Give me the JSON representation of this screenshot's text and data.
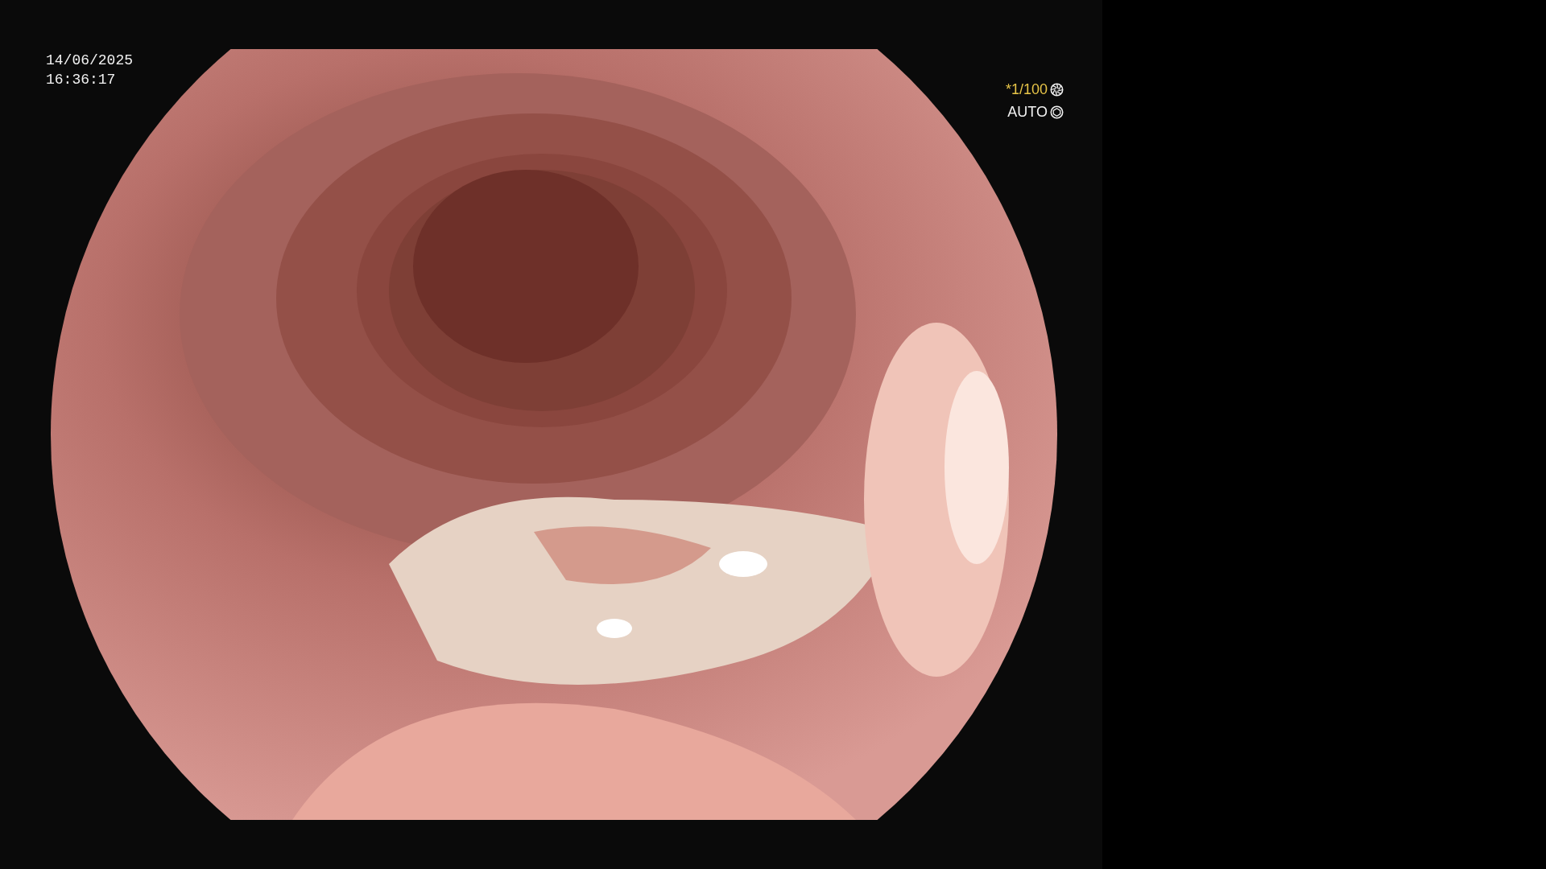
{
  "timestamp": {
    "date": "14/06/2025",
    "time": "16:36:17"
  },
  "exposure": {
    "shutter": "*1/100",
    "mode": "AUTO"
  }
}
